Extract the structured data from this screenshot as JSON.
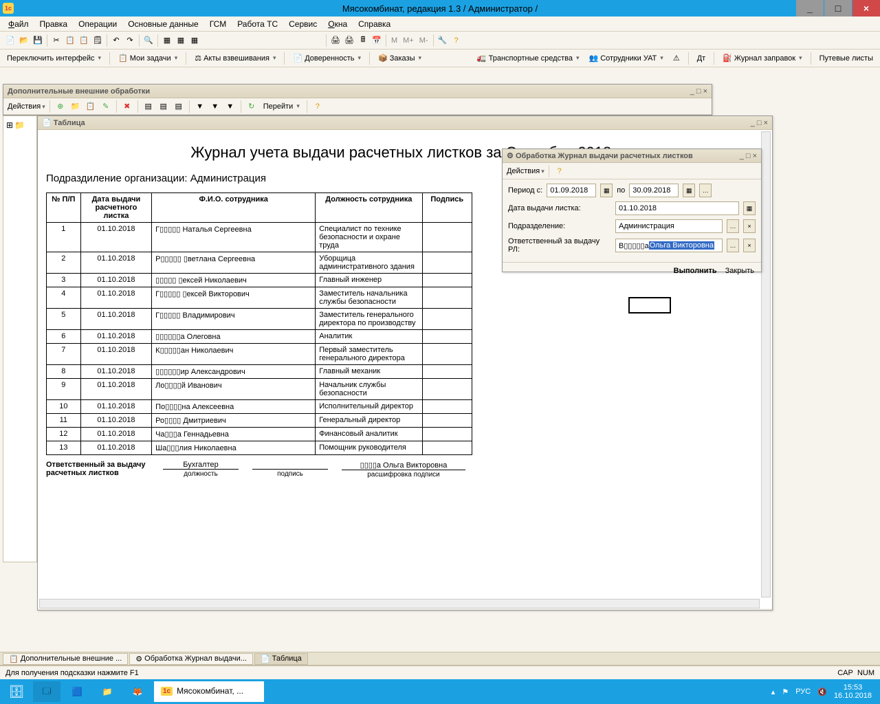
{
  "title": "Мясокомбинат, редакция 1.3 / Администратор /",
  "menu": [
    "Файл",
    "Правка",
    "Операции",
    "Основные данные",
    "ГСМ",
    "Работа ТС",
    "Сервис",
    "Окна",
    "Справка"
  ],
  "toolbar_letters": [
    "M",
    "M+",
    "M-"
  ],
  "toolbar2": {
    "switch": "Переключить интерфейс",
    "tasks": "Мои задачи",
    "acts": "Акты взвешивания",
    "dov": "Доверенность",
    "orders": "Заказы",
    "ts": "Транспортные средства",
    "emp": "Сотрудники УАТ",
    "dt": "Дт",
    "fuel": "Журнал заправок",
    "trip": "Путевые листы"
  },
  "dop_title": "Дополнительные внешние обработки",
  "actions_label": "Действия",
  "go_label": "Перейти",
  "table_win_title": "Таблица",
  "doc": {
    "title": "Журнал учета выдачи расчетных листков за Сентябрь 2018г.",
    "subdiv": "Подраздиление организации: Администрация",
    "headers": [
      "№ П/П",
      "Дата выдачи расчетного листка",
      "Ф.И.О. сотрудника",
      "Должность сотрудника",
      "Подпись"
    ],
    "rows": [
      {
        "n": "1",
        "d": "01.10.2018",
        "fio": "Г▯▯▯▯▯ Наталья Сергеевна",
        "pos": "Специалист по технике безопасности и охране труда"
      },
      {
        "n": "2",
        "d": "01.10.2018",
        "fio": "Р▯▯▯▯▯ ▯ветлана Сергеевна",
        "pos": "Уборщица административного здания"
      },
      {
        "n": "3",
        "d": "01.10.2018",
        "fio": "▯▯▯▯▯ ▯ексей Николаевич",
        "pos": "Главный инженер"
      },
      {
        "n": "4",
        "d": "01.10.2018",
        "fio": "Г▯▯▯▯▯ ▯ексей Викторович",
        "pos": "Заместитель начальника службы безопасности"
      },
      {
        "n": "5",
        "d": "01.10.2018",
        "fio": "Г▯▯▯▯▯ Владимирович",
        "pos": "Заместитель генерального директора по производству"
      },
      {
        "n": "6",
        "d": "01.10.2018",
        "fio": "▯▯▯▯▯▯а Олеговна",
        "pos": "Аналитик"
      },
      {
        "n": "7",
        "d": "01.10.2018",
        "fio": "К▯▯▯▯▯ан Николаевич",
        "pos": "Первый заместитель генерального директора"
      },
      {
        "n": "8",
        "d": "01.10.2018",
        "fio": "▯▯▯▯▯▯ир Александрович",
        "pos": "Главный механик"
      },
      {
        "n": "9",
        "d": "01.10.2018",
        "fio": "Ло▯▯▯▯й Иванович",
        "pos": "Начальник службы безопасности"
      },
      {
        "n": "10",
        "d": "01.10.2018",
        "fio": "По▯▯▯▯на Алексеевна",
        "pos": "Исполнительный директор"
      },
      {
        "n": "11",
        "d": "01.10.2018",
        "fio": "Ро▯▯▯▯ Дмитриевич",
        "pos": "Генеральный директор"
      },
      {
        "n": "12",
        "d": "01.10.2018",
        "fio": "Ча▯▯▯а Геннадьевна",
        "pos": "Финансовый аналитик"
      },
      {
        "n": "13",
        "d": "01.10.2018",
        "fio": "Ша▯▯▯лия Николаевна",
        "pos": "Помощник руководителя"
      }
    ],
    "resp_label": "Ответственный за выдачу расчетных листков",
    "resp_pos": "Бухгалтер",
    "sig_pos": "должность",
    "sig_sign": "подпись",
    "sig_dec": "расшифровка подписи",
    "resp_name": "▯▯▯▯а Ольга Викторовна"
  },
  "obr": {
    "title": "Обработка  Журнал выдачи расчетных листков",
    "actions": "Действия",
    "period_lbl": "Период с:",
    "period_from": "01.09.2018",
    "period_to_lbl": "по",
    "period_to": "30.09.2018",
    "date_lbl": "Дата выдачи листка:",
    "date_val": "01.10.2018",
    "subdiv_lbl": "Подразделение:",
    "subdiv_val": "Администрация",
    "resp_lbl": "Ответственный за выдачу РЛ:",
    "resp_pre": "В▯▯▯▯▯а ",
    "resp_val": "Ольга Викторовна",
    "execute": "Выполнить",
    "close": "Закрыть"
  },
  "task_tabs": [
    "Дополнительные внешние ...",
    "Обработка  Журнал выдачи...",
    "Таблица"
  ],
  "status_hint": "Для получения подсказки нажмите F1",
  "status_cap": "CAP",
  "status_num": "NUM",
  "os_task": "Мясокомбинат, ...",
  "tray_lang": "РУС",
  "tray_time": "15:53",
  "tray_date": "16.10.2018"
}
